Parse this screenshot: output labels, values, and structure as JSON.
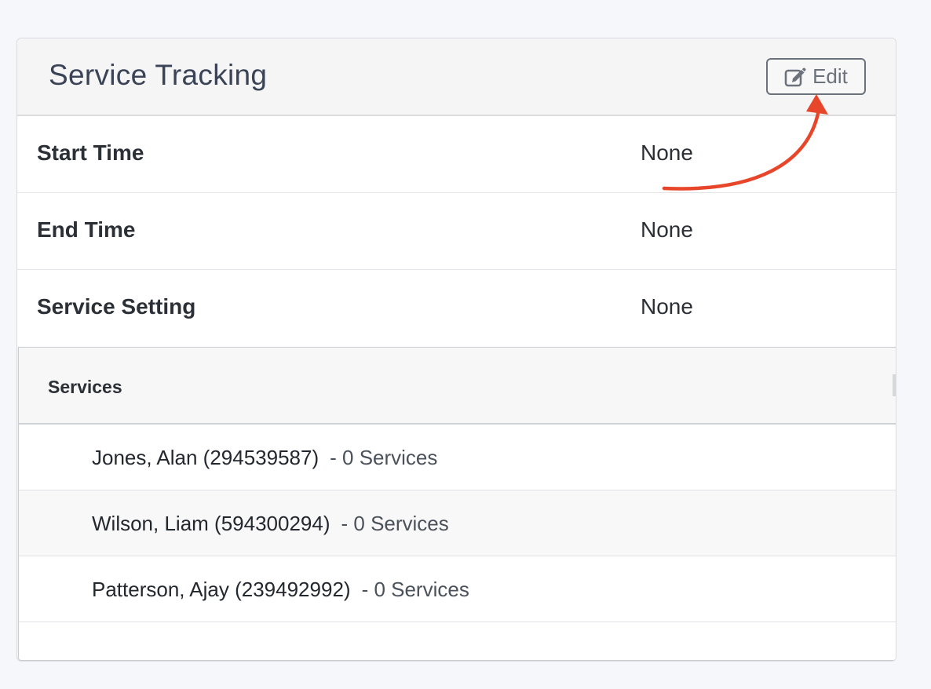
{
  "card": {
    "title": "Service Tracking",
    "edit_button": {
      "label": "Edit",
      "icon": "edit-icon"
    }
  },
  "info_rows": [
    {
      "label": "Start Time",
      "value": "None"
    },
    {
      "label": "End Time",
      "value": "None"
    },
    {
      "label": "Service Setting",
      "value": "None"
    }
  ],
  "services": {
    "title": "Services",
    "items": [
      {
        "name": "Jones, Alan (294539587)",
        "count": "- 0 Services"
      },
      {
        "name": "Wilson, Liam (594300294)",
        "count": "- 0 Services"
      },
      {
        "name": "Patterson, Ajay (239492992)",
        "count": "- 0 Services"
      }
    ]
  },
  "annotation": {
    "arrow_color": "#e8462a"
  },
  "colors": {
    "page_bg": "#f6f7fb",
    "title_text": "#3a4456",
    "edit_button": "#6c727c"
  }
}
